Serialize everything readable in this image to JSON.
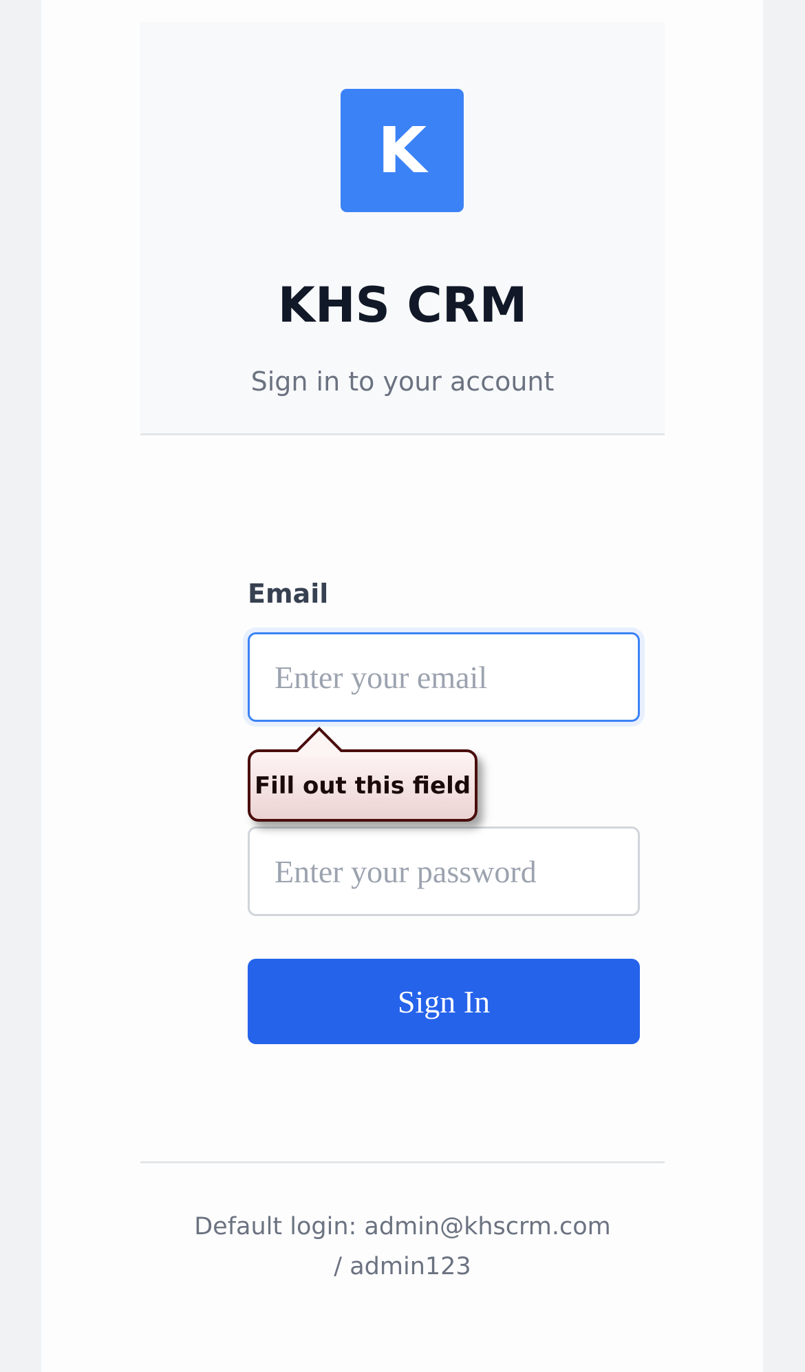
{
  "header": {
    "logo_letter": "K",
    "title": "KHS CRM",
    "subtitle": "Sign in to your account"
  },
  "form": {
    "email_label": "Email",
    "email_value": "",
    "email_placeholder": "Enter your email",
    "password_value": "",
    "password_placeholder": "Enter your password",
    "submit_label": "Sign In"
  },
  "validation": {
    "tooltip_text": "Fill out this field"
  },
  "footer": {
    "default_login_line1": "Default login: admin@khscrm.com",
    "default_login_line2": "/ admin123"
  },
  "colors": {
    "accent": "#3b82f6",
    "button": "#2563eb",
    "tooltip_border": "#4a0d0d"
  }
}
